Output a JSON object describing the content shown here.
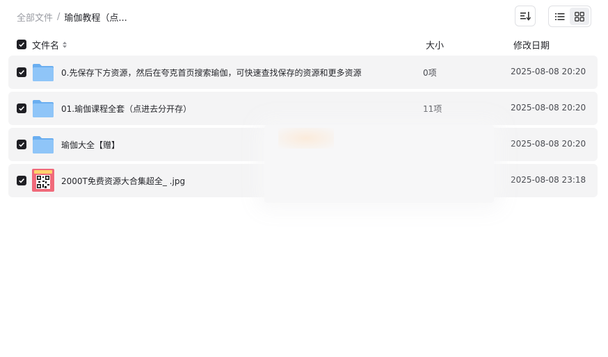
{
  "breadcrumb": {
    "root": "全部文件",
    "separator": "/",
    "current": "瑜伽教程（点..."
  },
  "toolbar": {
    "sort_icon": "sort-icon",
    "list_view_icon": "list-view-icon",
    "grid_view_icon": "grid-view-icon",
    "active_view": "list"
  },
  "table": {
    "columns": {
      "name": "文件名",
      "size": "大小",
      "date": "修改日期"
    },
    "rows": [
      {
        "name": "0.先保存下方资源，然后在夸克首页搜索瑜伽，可快速查找保存的资源和更多资源",
        "size": "0项",
        "date": "2025-08-08 20:20",
        "type": "folder",
        "checked": true
      },
      {
        "name": "01.瑜伽课程全套（点进去分开存）",
        "size": "11项",
        "date": "2025-08-08 20:20",
        "type": "folder",
        "checked": true
      },
      {
        "name": "瑜伽大全【赠】",
        "size": "",
        "date": "2025-08-08 20:20",
        "type": "folder",
        "checked": true
      },
      {
        "name": "2000T免费资源大合集超全_ .jpg",
        "size": "",
        "date": "2025-08-08 23:18",
        "type": "image",
        "checked": true
      }
    ]
  },
  "colors": {
    "row_bg": "#f4f4f5",
    "folder": "#7cbaf5",
    "checkbox": "#1f1f24"
  }
}
